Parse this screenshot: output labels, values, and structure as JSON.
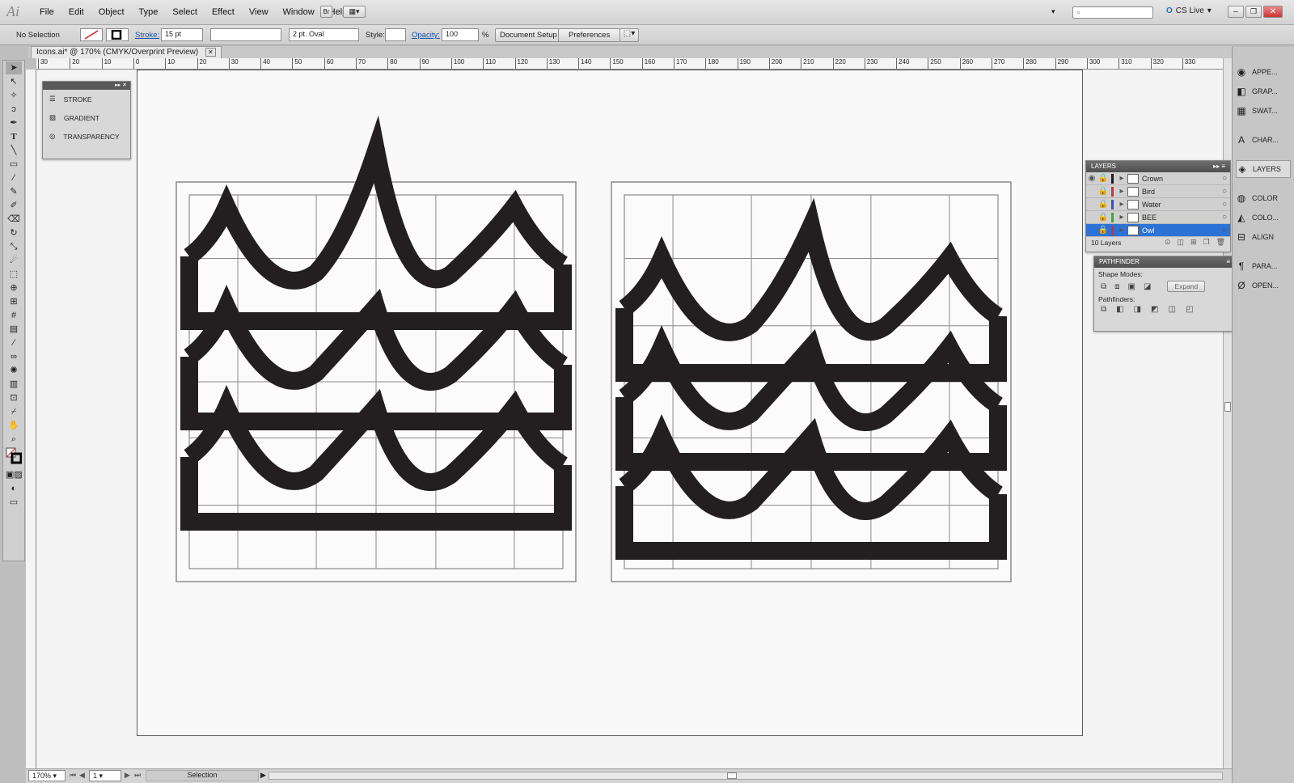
{
  "app": {
    "logo": "Ai"
  },
  "menu": [
    "File",
    "Edit",
    "Object",
    "Type",
    "Select",
    "Effect",
    "View",
    "Window",
    "Help"
  ],
  "menubar": {
    "br_label": "Br",
    "cs_live": "CS Live"
  },
  "control": {
    "selection": "No Selection",
    "stroke_label": "Stroke:",
    "stroke_value": "15 pt",
    "brush_value": "2 pt. Oval",
    "style_label": "Style:",
    "opacity_label": "Opacity:",
    "opacity_value": "100",
    "opacity_unit": "%",
    "doc_setup": "Document Setup",
    "preferences": "Preferences"
  },
  "document": {
    "tab": "Icons.ai* @ 170% (CMYK/Overprint Preview)"
  },
  "ruler": {
    "top": [
      "30",
      "20",
      "10",
      "0",
      "10",
      "20",
      "30",
      "40",
      "50",
      "60",
      "70",
      "80",
      "90",
      "100",
      "110",
      "120",
      "130",
      "140",
      "150",
      "160",
      "170",
      "180",
      "190",
      "200",
      "210",
      "220",
      "230",
      "240",
      "250",
      "260",
      "270",
      "280",
      "290",
      "300",
      "310",
      "320",
      "330"
    ]
  },
  "floating_panel": {
    "items": [
      "STROKE",
      "GRADIENT",
      "TRANSPARENCY"
    ]
  },
  "layers": {
    "title": "LAYERS",
    "rows": [
      {
        "name": "Crown",
        "color": "#1e1e1e"
      },
      {
        "name": "Bird",
        "color": "#d03030"
      },
      {
        "name": "Water",
        "color": "#3050d0"
      },
      {
        "name": "BEE",
        "color": "#30b030"
      },
      {
        "name": "Owl",
        "color": "#d03030"
      }
    ],
    "count": "10 Layers"
  },
  "pathfinder": {
    "title": "PATHFINDER",
    "shape_modes": "Shape Modes:",
    "expand": "Expand",
    "pathfinders": "Pathfinders:"
  },
  "dock": {
    "items": [
      "APPE...",
      "GRAP...",
      "SWAT...",
      "CHAR...",
      "LAYERS",
      "COLOR",
      "COLO...",
      "ALIGN",
      "PARA...",
      "OPEN..."
    ]
  },
  "status": {
    "zoom": "170%",
    "page": "1",
    "tool": "Selection"
  },
  "colors": {
    "ink": "#231f20",
    "grid": "#8a8a8a",
    "select": "#2d72d6"
  }
}
